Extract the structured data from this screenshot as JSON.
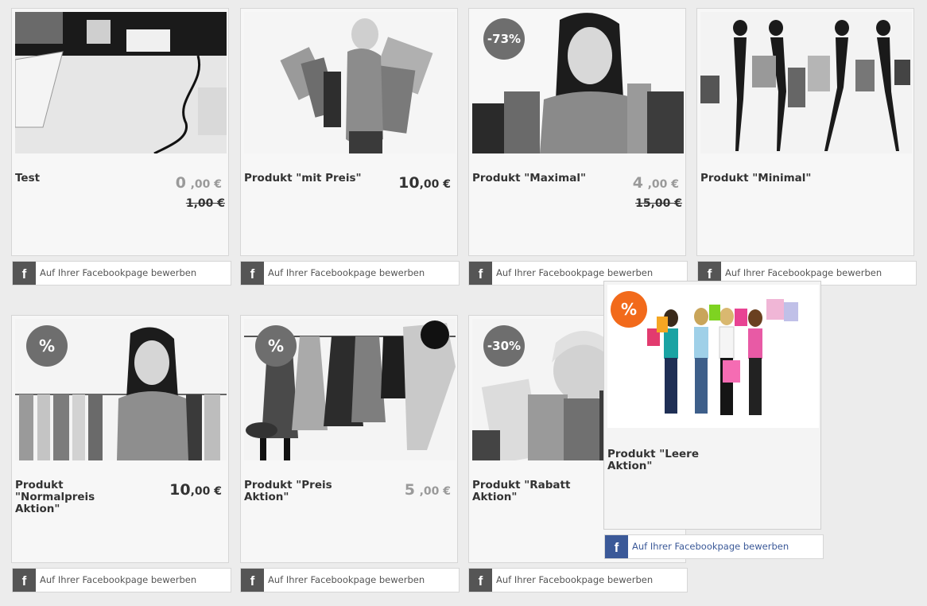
{
  "products": [
    {
      "title": "Test",
      "price_int": "0",
      "price_cents": ",00 €",
      "old_price": "1,00 €",
      "badge": ""
    },
    {
      "title": "Produkt \"mit Preis\"",
      "price_int": "10",
      "price_cents": ",00 €",
      "old_price": "",
      "badge": ""
    },
    {
      "title": "Produkt \"Maximal\"",
      "price_int": "4",
      "price_cents": ",00 €",
      "old_price": "15,00 €",
      "badge": "-73%"
    },
    {
      "title": "Produkt \"Minimal\"",
      "price_int": "",
      "price_cents": "",
      "old_price": "",
      "badge": ""
    },
    {
      "title": "Produkt \"Normalpreis Aktion\"",
      "price_int": "10",
      "price_cents": ",00 €",
      "old_price": "",
      "badge": "%"
    },
    {
      "title": "Produkt \"Preis Aktion\"",
      "price_int": "5",
      "price_cents": ",00 €",
      "old_price": "",
      "badge": "%"
    },
    {
      "title": "Produkt \"Rabatt Aktion\"",
      "price_int": "",
      "price_cents": "",
      "old_price": "",
      "badge": "-30%"
    },
    {
      "title": "Produkt \"Leere Aktion\"",
      "price_int": "",
      "price_cents": "",
      "old_price": "",
      "badge": "%"
    }
  ],
  "facebook": {
    "icon": "f",
    "label": "Auf Ihrer Facebookpage bewerben"
  },
  "colors": {
    "badge_default": "#6e6e6e",
    "badge_active": "#f26a1b",
    "facebook_blue": "#3b5998"
  }
}
